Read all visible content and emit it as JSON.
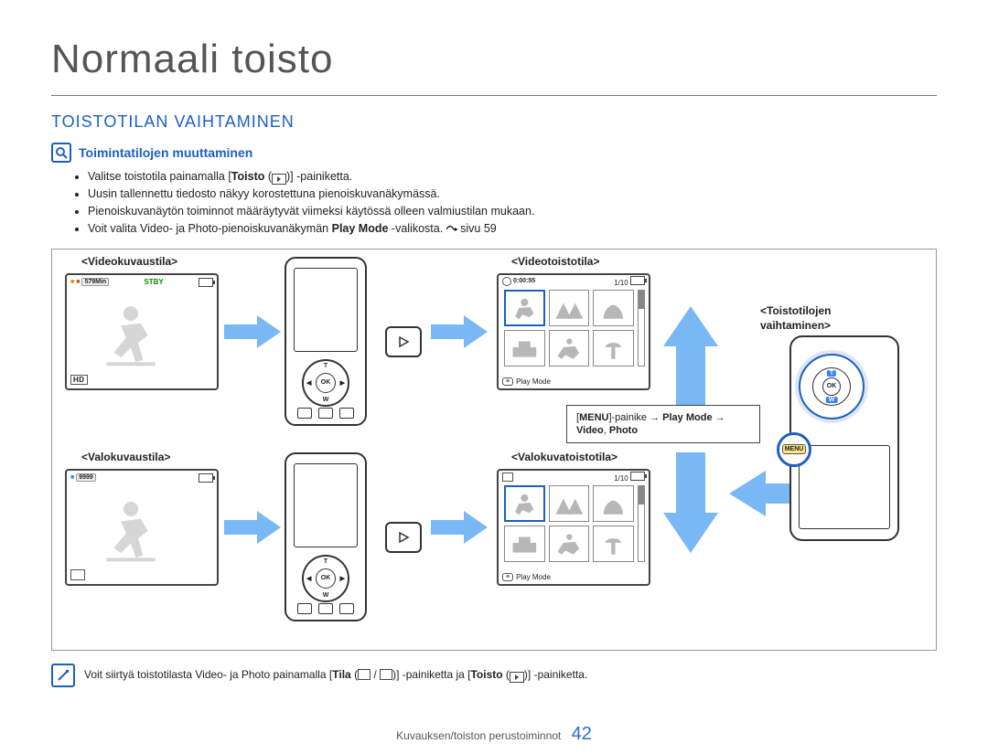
{
  "page_title": "Normaali toisto",
  "section_title": "TOISTOTILAN VAIHTAMINEN",
  "sub_title": "Toimintatilojen muuttaminen",
  "bullets": {
    "b1a": "Valitse toistotila painamalla [",
    "b1b": "Toisto",
    "b1c": " (",
    "b1d": ")] -painiketta.",
    "b2": "Uusin tallennettu tiedosto näkyy korostettuna pienoiskuvanäkymässä.",
    "b3": "Pienoiskuvanäytön toiminnot määräytyvät viimeksi käytössä olleen valmiustilan mukaan.",
    "b4a": "Voit valita Video- ja Photo-pienoiskuvanäkymän ",
    "b4b": "Play Mode",
    "b4c": " -valikosta. ",
    "b4d": "sivu 59"
  },
  "labels": {
    "video_rec": "<Videokuvaustila>",
    "photo_rec": "<Valokuvaustila>",
    "video_play": "<Videotoistotila>",
    "photo_play": "<Valokuvatoistotila>",
    "mode_switch1": "<Toistotilojen",
    "mode_switch2": "vaihtaminen>"
  },
  "screens": {
    "video_rec": {
      "minutes": "579Min",
      "status": "STBY",
      "badge": "HD"
    },
    "photo_rec": {
      "count": "9999"
    },
    "video_play": {
      "time": "0:00:55",
      "index": "1/10",
      "footer": "Play Mode"
    },
    "photo_play": {
      "index": "1/10",
      "footer": "Play Mode"
    }
  },
  "device": {
    "ok": "OK",
    "t": "T",
    "w": "W",
    "menu": "MENU"
  },
  "popup": {
    "l1a": "MENU",
    "l1b": "-painike  ",
    "l1c": "Play Mode",
    "l1d": "  ",
    "l2": "Video",
    "l2b": ", ",
    "l2c": "Photo"
  },
  "note": {
    "t1": "Voit siirtyä toistotilasta Video- ja Photo painamalla [",
    "t2": "Tila",
    "t3": " (",
    "t4": " / ",
    "t5": ")] -painiketta ja [",
    "t6": "Toisto",
    "t7": " (",
    "t8": ")] -painiketta."
  },
  "footer": {
    "section": "Kuvauksen/toiston perustoiminnot",
    "page": "42"
  },
  "arrow_symbol": "→"
}
